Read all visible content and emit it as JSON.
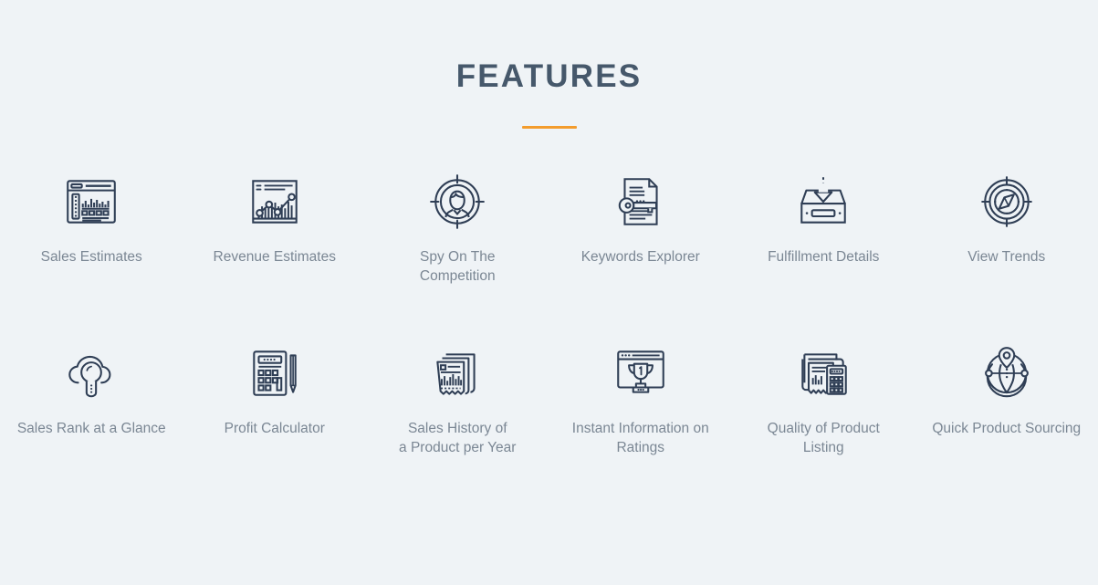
{
  "header": {
    "title": "FEATURES",
    "divider_color": "#f39c2d"
  },
  "theme": {
    "background": "#eff3f6",
    "title_color": "#46586b",
    "label_color": "#7b8794",
    "icon_stroke": "#2f3e55",
    "accent": "#f39c2d"
  },
  "features": {
    "rows": [
      {
        "items": [
          {
            "label": "Sales Estimates",
            "icon": "browser-bar-chart-icon"
          },
          {
            "label": "Revenue Estimates",
            "icon": "line-chart-frame-icon"
          },
          {
            "label": "Spy On The\nCompetition",
            "icon": "person-target-icon"
          },
          {
            "label": "Keywords Explorer",
            "icon": "document-key-icon"
          },
          {
            "label": "Fulfillment Details",
            "icon": "inbox-arrow-down-icon"
          },
          {
            "label": "View Trends",
            "icon": "compass-icon"
          }
        ]
      },
      {
        "items": [
          {
            "label": "Sales Rank at a Glance",
            "icon": "cloud-magnifier-icon"
          },
          {
            "label": "Profit Calculator",
            "icon": "calculator-pencil-icon"
          },
          {
            "label": "Sales History of\na Product per Year",
            "icon": "receipt-chart-icon"
          },
          {
            "label": "Instant Information on\nRatings",
            "icon": "browser-trophy-icon"
          },
          {
            "label": "Quality of Product\nListing",
            "icon": "documents-calculator-icon"
          },
          {
            "label": "Quick Product Sourcing",
            "icon": "globe-pin-icon"
          }
        ]
      }
    ]
  }
}
